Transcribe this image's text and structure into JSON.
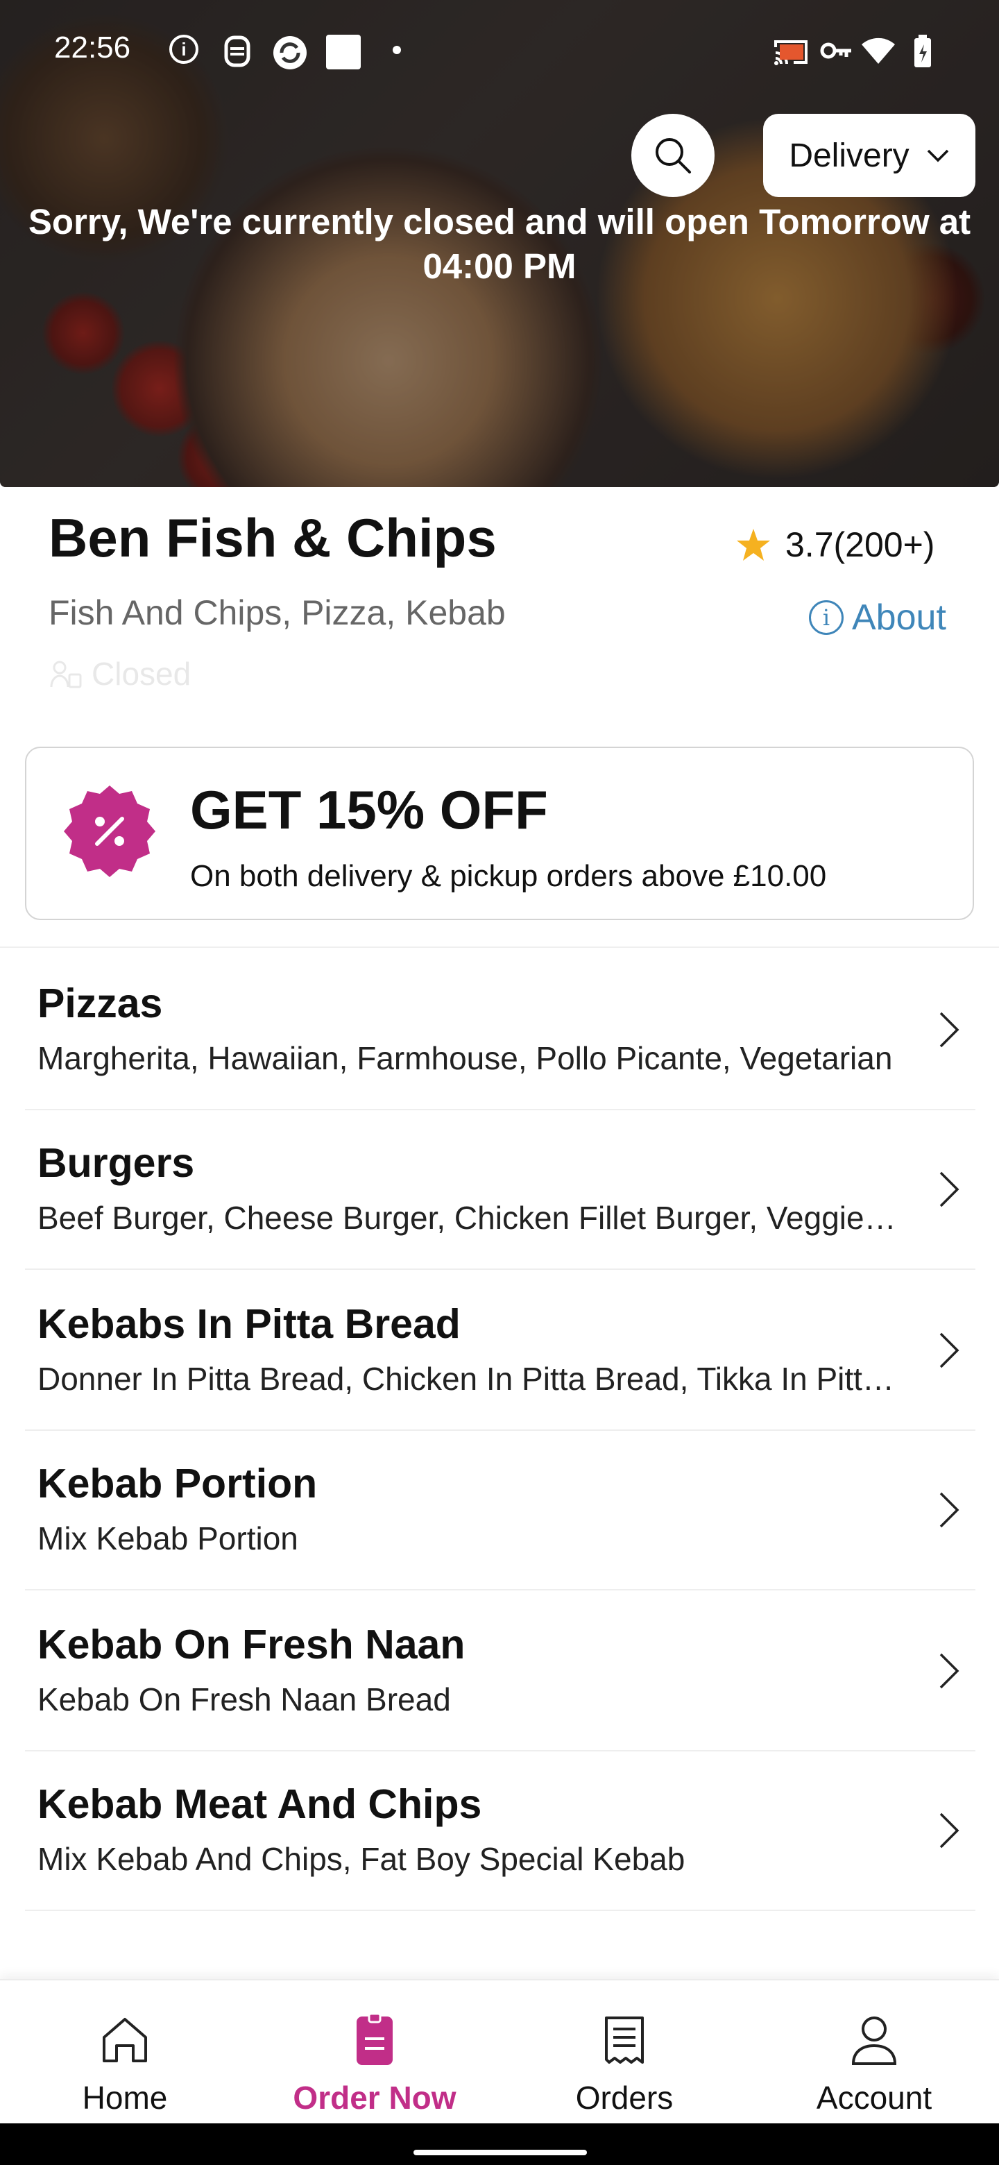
{
  "status_bar": {
    "time": "22:56"
  },
  "hero": {
    "closed_message": "Sorry, We're currently closed and will open Tomorrow at 04:00 PM",
    "order_mode": "Delivery"
  },
  "restaurant": {
    "name": "Ben Fish & Chips",
    "rating": "3.7(200+)",
    "cuisines": "Fish And Chips, Pizza, Kebab",
    "about_label": "About",
    "status": "Closed"
  },
  "offer": {
    "title": "GET 15% OFF",
    "subtitle": "On both delivery & pickup orders above £10.00",
    "badge_color": "#c12e88"
  },
  "menu": {
    "categories": [
      {
        "title": "Pizzas",
        "items": "Margherita, Hawaiian, Farmhouse, Pollo Picante, Vegetarian"
      },
      {
        "title": "Burgers",
        "items": "Beef Burger, Cheese Burger, Chicken Fillet Burger, Veggie Burger"
      },
      {
        "title": "Kebabs In Pitta Bread",
        "items": "Donner In Pitta Bread, Chicken In Pitta Bread, Tikka In Pitta Bread"
      },
      {
        "title": "Kebab Portion",
        "items": "Mix Kebab Portion"
      },
      {
        "title": "Kebab On Fresh Naan",
        "items": "Kebab On Fresh Naan Bread"
      },
      {
        "title": "Kebab Meat And Chips",
        "items": "Mix Kebab And Chips, Fat Boy Special Kebab"
      }
    ]
  },
  "bottom_nav": {
    "items": [
      {
        "label": "Home",
        "icon": "home-icon"
      },
      {
        "label": "Order Now",
        "icon": "order-icon"
      },
      {
        "label": "Orders",
        "icon": "receipt-icon"
      },
      {
        "label": "Account",
        "icon": "person-icon"
      }
    ],
    "active_color": "#c12e88"
  },
  "colors": {
    "accent": "#c12e88",
    "link": "#3f86b9",
    "star": "#f5b120"
  }
}
